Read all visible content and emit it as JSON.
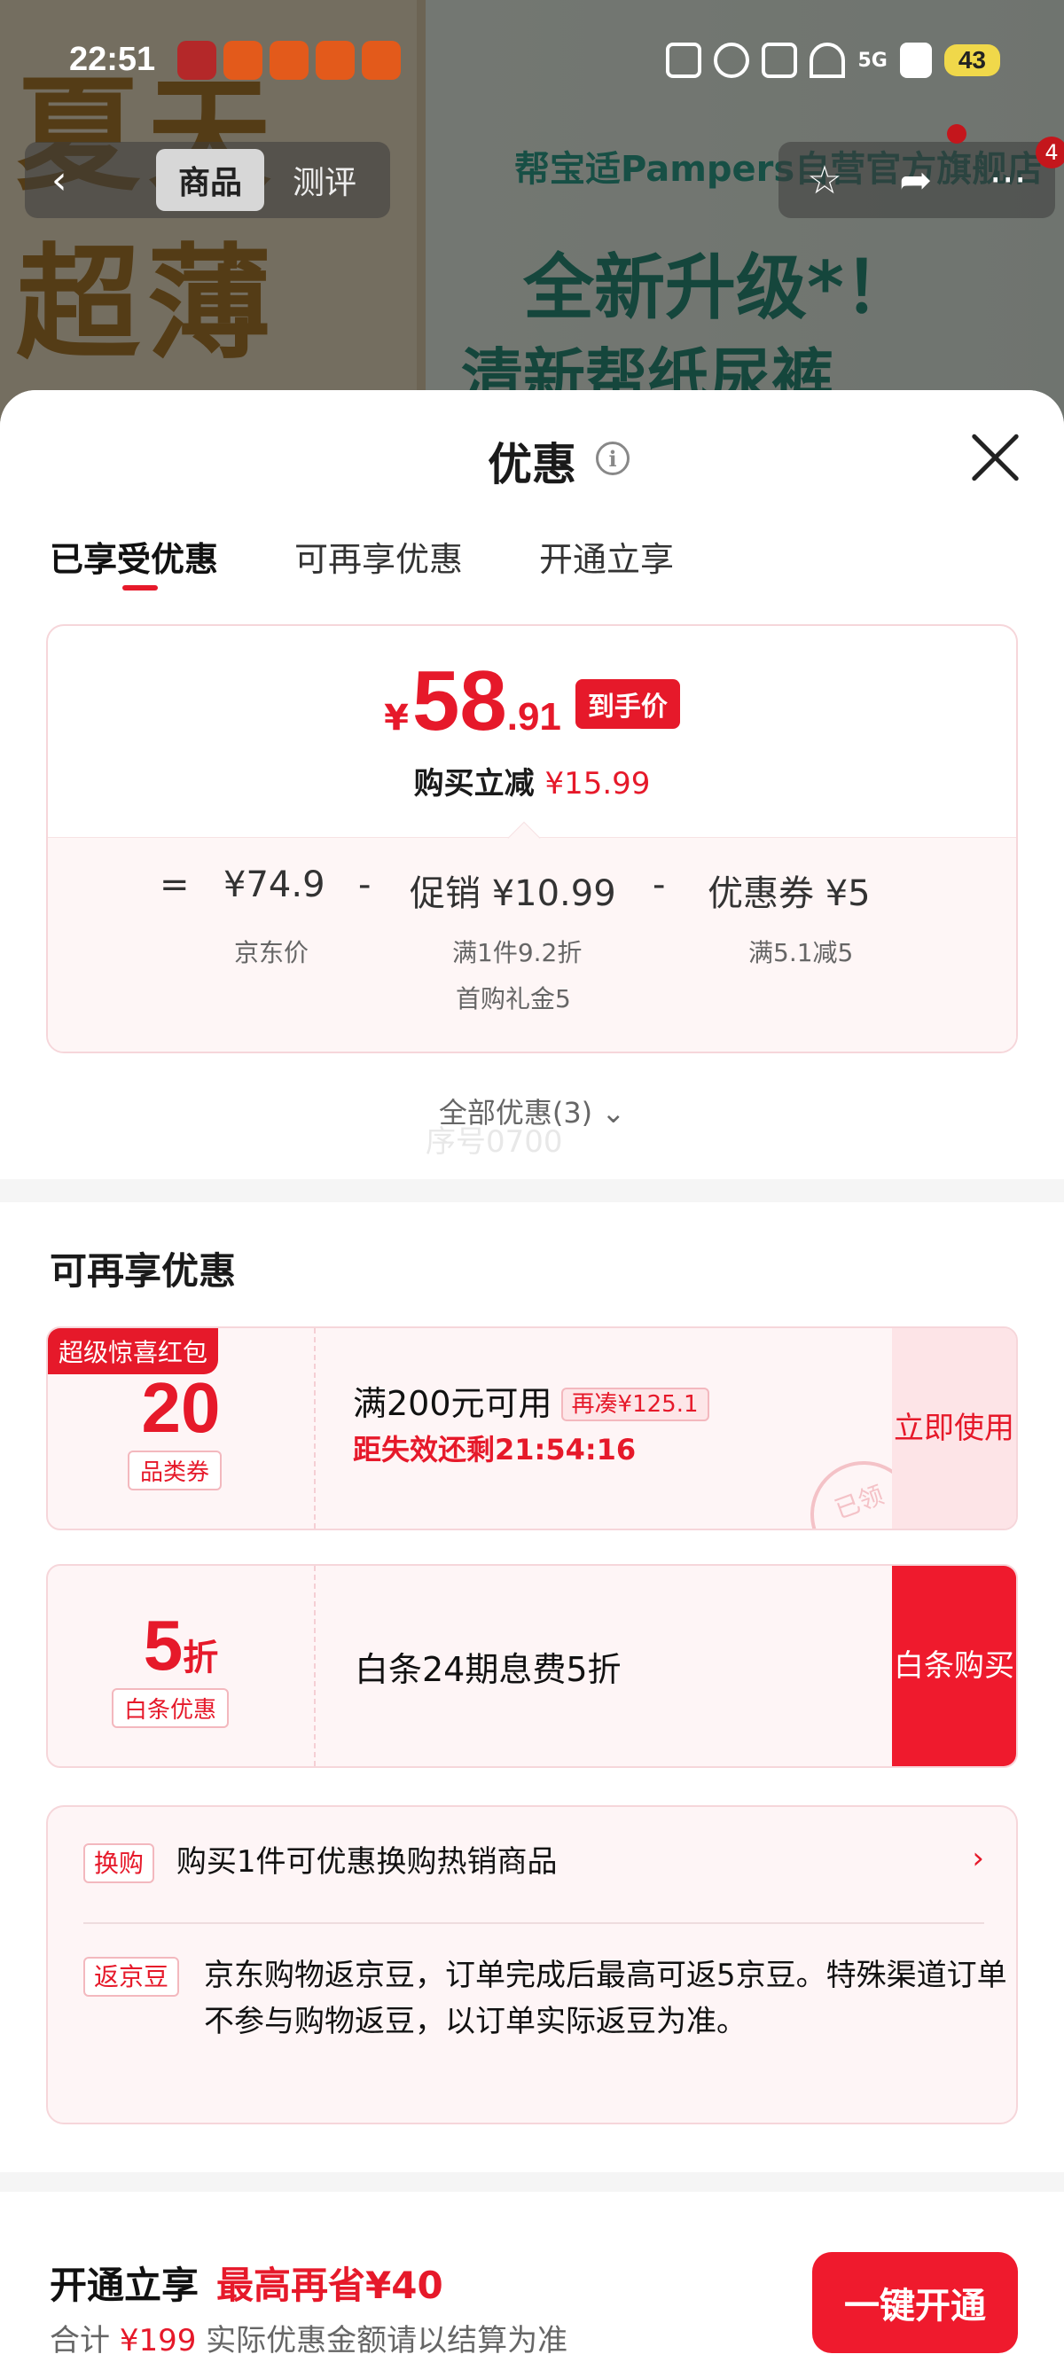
{
  "status_bar": {
    "time": "22:51",
    "battery": "43",
    "network": "5G"
  },
  "product_nav": {
    "tab_active": "商品",
    "tab_other": "测评",
    "badge": "4"
  },
  "background": {
    "left_text_1": "夏天",
    "left_text_2": "超薄",
    "brand": "帮宝适Pampers自营官方旗舰店",
    "headline": "全新升级*！",
    "subline": "清新帮纸尿裤"
  },
  "sheet": {
    "title": "优惠",
    "tabs": [
      "已享受优惠",
      "可再享优惠",
      "开通立享"
    ],
    "price": {
      "currency": "¥",
      "integer": "58",
      "decimal": ".91",
      "tag": "到手价",
      "reduce_label": "购买立减",
      "reduce_amount": "¥15.99"
    },
    "formula": {
      "eq": "=",
      "base": "¥74.9",
      "minus": "-",
      "promo_label": "促销 ¥10.99",
      "coupon_label": "优惠券 ¥5",
      "base_sub": "京东价",
      "promo_sub_1": "满1件9.2折",
      "promo_sub_2": "首购礼金5",
      "coupon_sub": "满5.1减5"
    },
    "all_discounts": "全部优惠(3)",
    "watermark": "序号0700"
  },
  "more_section": {
    "title": "可再享优惠",
    "coupon1": {
      "ribbon": "超级惊喜红包",
      "value": "20",
      "type": "品类券",
      "condition": "满200元可用",
      "chip": "再凑¥125.1",
      "timer": "距失效还剩21:54:16",
      "action": "立即使用",
      "stamp": "已领"
    },
    "coupon2": {
      "value": "5",
      "unit": "折",
      "type": "白条优惠",
      "condition": "白条24期息费5折",
      "action": "白条购买"
    },
    "exchange": {
      "tag": "换购",
      "text": "购买1件可优惠换购热销商品"
    },
    "beans": {
      "tag": "返京豆",
      "text": "京东购物返京豆，订单完成后最高可返5京豆。特殊渠道订单不参与购物返豆，以订单实际返豆为准。"
    }
  },
  "bottom_bar": {
    "title": "开通立享",
    "save": "最高再省¥40",
    "sub_prefix": "合计",
    "sub_amount": "¥199",
    "sub_suffix": "实际优惠金额请以结算为准",
    "button": "一键开通"
  },
  "colors": {
    "accent": "#e6192a",
    "card_bg": "#fef5f6",
    "card_border": "#f6d6da"
  }
}
